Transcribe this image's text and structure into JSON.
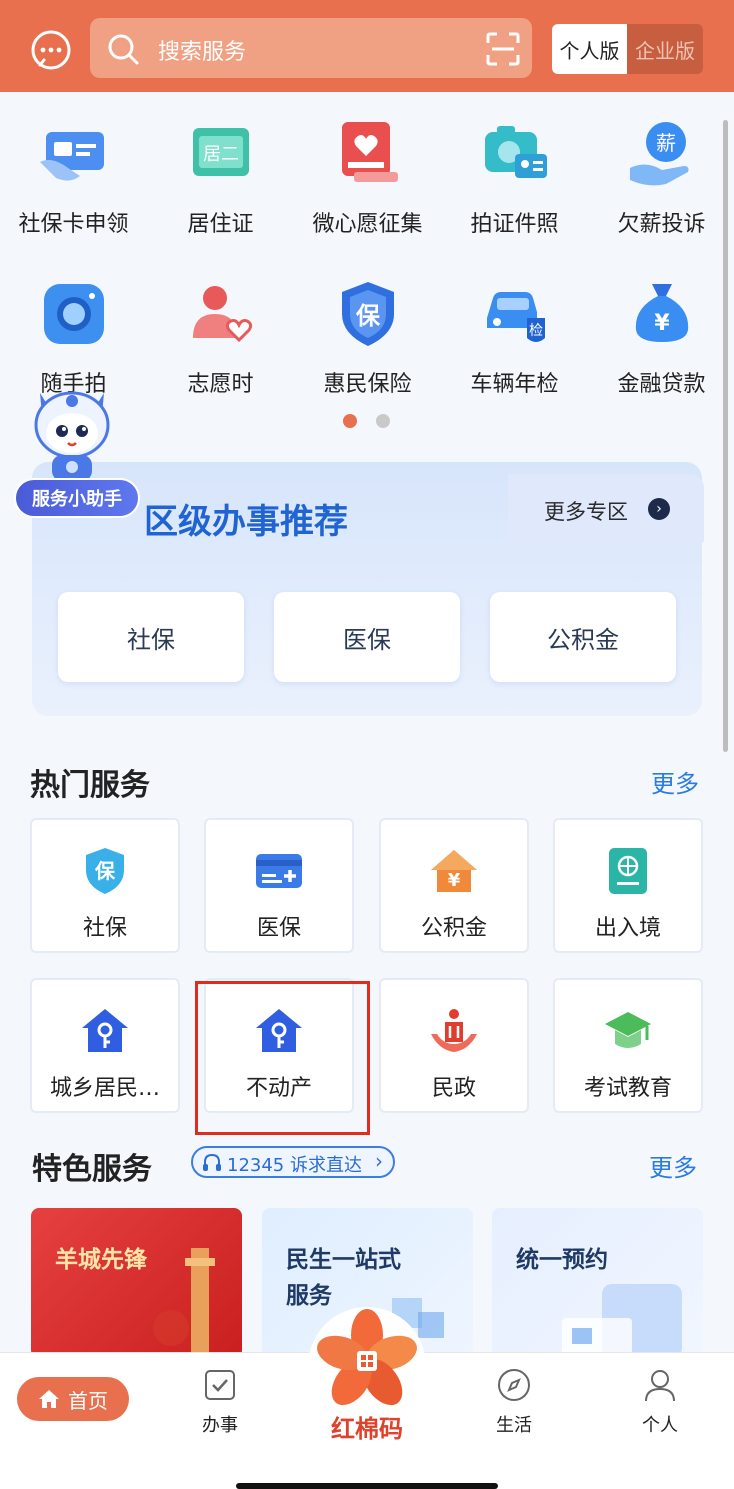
{
  "header": {
    "search_placeholder": "搜索服务",
    "version_personal": "个人版",
    "version_enterprise": "企业版"
  },
  "quick_grid": {
    "row1": [
      {
        "label": "社保卡申领",
        "icon": "social-card-icon"
      },
      {
        "label": "居住证",
        "icon": "residence-permit-icon"
      },
      {
        "label": "微心愿征集",
        "icon": "wish-icon"
      },
      {
        "label": "拍证件照",
        "icon": "id-photo-camera-icon"
      },
      {
        "label": "欠薪投诉",
        "icon": "wage-complaint-icon"
      }
    ],
    "row2": [
      {
        "label": "随手拍",
        "icon": "camera-icon"
      },
      {
        "label": "志愿时",
        "icon": "volunteer-icon"
      },
      {
        "label": "惠民保险",
        "icon": "insurance-shield-icon"
      },
      {
        "label": "车辆年检",
        "icon": "car-inspection-icon"
      },
      {
        "label": "金融贷款",
        "icon": "money-bag-icon"
      }
    ],
    "page_indicator": {
      "pages": 2,
      "active": 1
    }
  },
  "assistant": {
    "label": "服务小助手"
  },
  "district": {
    "title": "区级办事推荐",
    "more_label": "更多专区",
    "buttons": [
      "社保",
      "医保",
      "公积金"
    ]
  },
  "hot_services": {
    "title": "热门服务",
    "more_label": "更多",
    "items": [
      {
        "label": "社保",
        "icon": "shield-icon"
      },
      {
        "label": "医保",
        "icon": "medical-card-icon"
      },
      {
        "label": "公积金",
        "icon": "house-fund-icon"
      },
      {
        "label": "出入境",
        "icon": "passport-icon"
      },
      {
        "label": "城乡居民…",
        "icon": "house-key-icon"
      },
      {
        "label": "不动产",
        "icon": "house-key-icon"
      },
      {
        "label": "民政",
        "icon": "civil-affairs-icon"
      },
      {
        "label": "考试教育",
        "icon": "graduation-cap-icon"
      }
    ]
  },
  "featured": {
    "title": "特色服务",
    "hotline": "12345 诉求直达",
    "more_label": "更多",
    "cards": [
      {
        "title": "羊城先锋"
      },
      {
        "title_line1": "民生一站式",
        "title_line2": "服务"
      },
      {
        "title": "统一预约"
      }
    ]
  },
  "bottom_nav": {
    "home": "首页",
    "tasks": "办事",
    "center": "红棉码",
    "life": "生活",
    "profile": "个人"
  },
  "colors": {
    "brand": "#e8704e",
    "link": "#2b7be0",
    "highlight": "#e02b1d"
  }
}
